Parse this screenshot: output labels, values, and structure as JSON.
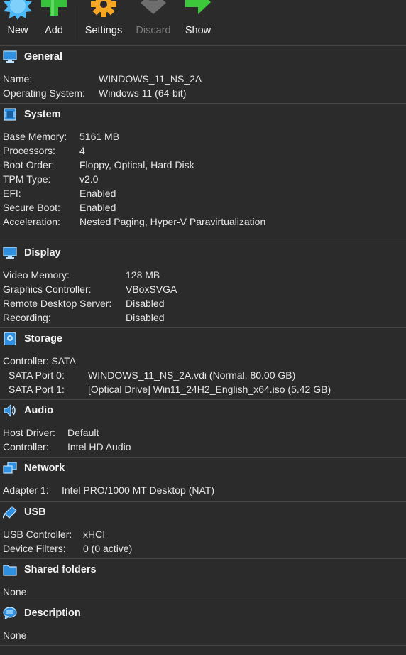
{
  "toolbar": {
    "new_label": "New",
    "add_label": "Add",
    "settings_label": "Settings",
    "discard_label": "Discard",
    "show_label": "Show"
  },
  "sections": {
    "general": {
      "title": "General",
      "icon": "monitor-icon",
      "rows": [
        {
          "label": "Name:",
          "value": "WINDOWS_11_NS_2A"
        },
        {
          "label": "Operating System:",
          "value": "Windows 11 (64-bit)"
        }
      ]
    },
    "system": {
      "title": "System",
      "icon": "chip-icon",
      "rows": [
        {
          "label": "Base Memory:",
          "value": "5161 MB"
        },
        {
          "label": "Processors:",
          "value": "4"
        },
        {
          "label": "Boot Order:",
          "value": "Floppy, Optical, Hard Disk"
        },
        {
          "label": "TPM Type:",
          "value": "v2.0"
        },
        {
          "label": "EFI:",
          "value": "Enabled"
        },
        {
          "label": "Secure Boot:",
          "value": "Enabled"
        },
        {
          "label": "Acceleration:",
          "value": "Nested Paging, Hyper-V Paravirtualization"
        }
      ]
    },
    "display": {
      "title": "Display",
      "icon": "monitor-icon",
      "rows": [
        {
          "label": "Video Memory:",
          "value": "128 MB"
        },
        {
          "label": "Graphics Controller:",
          "value": "VBoxSVGA"
        },
        {
          "label": "Remote Desktop Server:",
          "value": "Disabled"
        },
        {
          "label": "Recording:",
          "value": "Disabled"
        }
      ]
    },
    "storage": {
      "title": "Storage",
      "icon": "disk-icon",
      "controller": "Controller: SATA",
      "rows": [
        {
          "label": "SATA Port 0:",
          "value": "WINDOWS_11_NS_2A.vdi (Normal, 80.00 GB)"
        },
        {
          "label": "SATA Port 1:",
          "value": "[Optical Drive] Win11_24H2_English_x64.iso (5.42 GB)"
        }
      ]
    },
    "audio": {
      "title": "Audio",
      "icon": "speaker-icon",
      "rows": [
        {
          "label": "Host Driver:",
          "value": "Default"
        },
        {
          "label": "Controller:",
          "value": "Intel HD Audio"
        }
      ]
    },
    "network": {
      "title": "Network",
      "icon": "network-icon",
      "rows": [
        {
          "label": "Adapter 1:",
          "value": "Intel PRO/1000 MT Desktop (NAT)"
        }
      ]
    },
    "usb": {
      "title": "USB",
      "icon": "usb-icon",
      "rows": [
        {
          "label": "USB Controller:",
          "value": "xHCI"
        },
        {
          "label": "Device Filters:",
          "value": "0 (0 active)"
        }
      ]
    },
    "shared_folders": {
      "title": "Shared folders",
      "icon": "folder-icon",
      "value": "None"
    },
    "description": {
      "title": "Description",
      "icon": "speech-bubble-icon",
      "value": "None"
    }
  },
  "colors": {
    "background": "#2b2b2b",
    "separator": "#454545",
    "text": "#e6e6e6",
    "icon_blue": "#2f8fe0",
    "new_icon": "#4cb8f5",
    "add_icon": "#36c23a",
    "settings_icon": "#f5a623",
    "discard_icon": "#6e6e6e",
    "show_icon": "#3cc83a"
  }
}
